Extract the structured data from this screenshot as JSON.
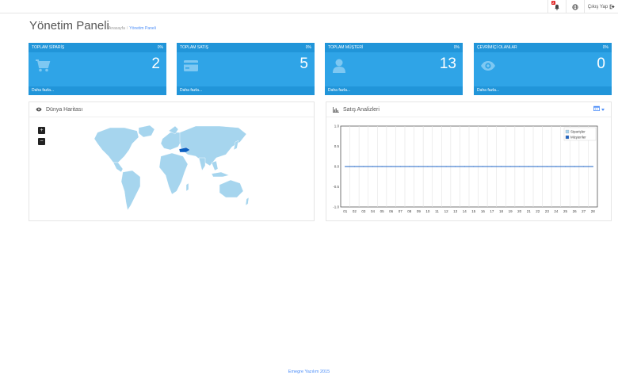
{
  "topbar": {
    "notif_badge": "2",
    "logout_label": "Çıkış Yap"
  },
  "page": {
    "title": "Yönetim Paneli",
    "breadcrumb_home": "Anasayfa",
    "breadcrumb_sep": "/",
    "breadcrumb_current": "Yönetim Paneli"
  },
  "tiles": [
    {
      "label": "TOPLAM SİPARİŞ",
      "percent": "0%",
      "value": "2",
      "more": "Daha fazla...",
      "icon": "cart-icon"
    },
    {
      "label": "TOPLAM SATIŞ",
      "percent": "0%",
      "value": "5",
      "more": "Daha fazla...",
      "icon": "credit-card-icon"
    },
    {
      "label": "TOPLAM MÜŞTERİ",
      "percent": "0%",
      "value": "13",
      "more": "Daha fazla...",
      "icon": "user-icon"
    },
    {
      "label": "ÇEVRİMİÇİ OLANLAR",
      "percent": "0%",
      "value": "0",
      "more": "Daha fazla...",
      "icon": "eye-icon"
    }
  ],
  "map_panel": {
    "title": "Dünya Haritası",
    "zoom_in": "+",
    "zoom_out": "−"
  },
  "chart_panel": {
    "title": "Satış Analizleri"
  },
  "chart_data": {
    "type": "line",
    "title": "",
    "x": [
      "01",
      "02",
      "03",
      "04",
      "05",
      "06",
      "07",
      "08",
      "09",
      "10",
      "11",
      "12",
      "13",
      "14",
      "15",
      "16",
      "17",
      "18",
      "19",
      "20",
      "21",
      "22",
      "23",
      "24",
      "25",
      "26",
      "27",
      "28"
    ],
    "series": [
      {
        "name": "Siparişler",
        "values": [
          0,
          0,
          0,
          0,
          0,
          0,
          0,
          0,
          0,
          0,
          0,
          0,
          0,
          0,
          0,
          0,
          0,
          0,
          0,
          0,
          0,
          0,
          0,
          0,
          0,
          0,
          0,
          0
        ],
        "color": "#a8d4f0"
      },
      {
        "name": "Müşteriler",
        "values": [
          0,
          0,
          0,
          0,
          0,
          0,
          0,
          0,
          0,
          0,
          0,
          0,
          0,
          0,
          0,
          0,
          0,
          0,
          0,
          0,
          0,
          0,
          0,
          0,
          0,
          0,
          0,
          0
        ],
        "color": "#1e63c4"
      }
    ],
    "yticks": [
      "1.0",
      "0.5",
      "0.0",
      "-0.5",
      "-1.0"
    ],
    "ylim": [
      -1,
      1
    ],
    "grid": true,
    "legend_position": "top-right"
  },
  "colors": {
    "tile_bg": "#2fa4e7",
    "tile_header": "#2195d9",
    "map_land": "#a6d5ee",
    "map_highlight": "#0b5fc1",
    "link": "#4b8df8"
  },
  "footer": {
    "text": "Emegre Yazılım 2015"
  }
}
